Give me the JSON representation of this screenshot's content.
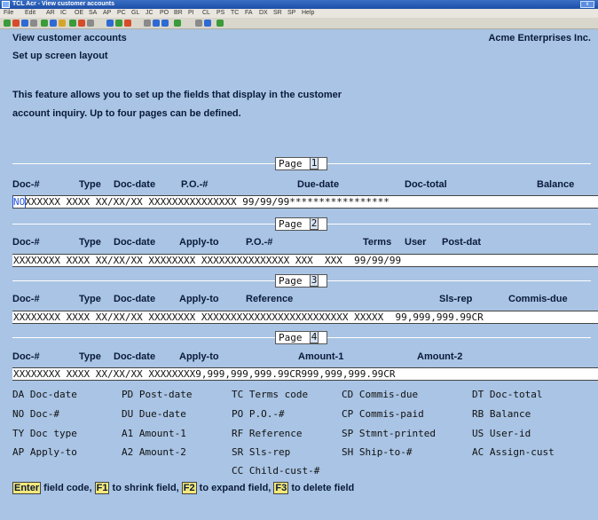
{
  "window": {
    "title": "TCL Acr - View customer accounts"
  },
  "menu": [
    "File",
    "Edit",
    "AR",
    "IC",
    "OE",
    "SA",
    "AP",
    "PC",
    "GL",
    "JC",
    "PO",
    "BR",
    "PI",
    "CL",
    "PS",
    "TC",
    "FA",
    "DX",
    "SR",
    "SP",
    "Help"
  ],
  "header": {
    "screen_title": "View customer accounts",
    "company": "Acme Enterprises Inc.",
    "subtitle": "Set up screen layout",
    "desc_line1": "This feature allows you to set up the fields that display in the customer",
    "desc_line2": "account inquiry.  Up to four pages can be defined."
  },
  "pages": [
    {
      "label": "Page",
      "number": "1",
      "headers": [
        "Doc-#",
        "Type",
        "Doc-date",
        "P.O.-#",
        "Due-date",
        "Doc-total",
        "Balance"
      ],
      "cursor": "NO",
      "field_prefix": "X",
      "field_rest": "XXXXX XXXX XX/XX/XX XXXXXXXXXXXXXXX 99/99/99*****************"
    },
    {
      "label": "Page",
      "number": "2",
      "headers": [
        "Doc-#",
        "Type",
        "Doc-date",
        "Apply-to",
        "P.O.-#",
        "Terms",
        "User",
        "Post-dat"
      ],
      "field": "XXXXXXXX XXXX XX/XX/XX XXXXXXXX XXXXXXXXXXXXXXX XXX  XXX  99/99/99"
    },
    {
      "label": "Page",
      "number": "3",
      "headers": [
        "Doc-#",
        "Type",
        "Doc-date",
        "Apply-to",
        "Reference",
        "Sls-rep",
        "Commis-due"
      ],
      "field": "XXXXXXXX XXXX XX/XX/XX XXXXXXXX XXXXXXXXXXXXXXXXXXXXXXXXX XXXXX  99,999,999.99CR"
    },
    {
      "label": "Page",
      "number": "4",
      "headers": [
        "Doc-#",
        "Type",
        "Doc-date",
        "Apply-to",
        "Amount-1",
        "Amount-2"
      ],
      "field": "XXXXXXXX XXXX XX/XX/XX XXXXXXXX9,999,999,999.99CR999,999,999.99CR"
    }
  ],
  "codes": [
    [
      "DA Doc-date",
      "PD Post-date",
      "TC Terms code",
      "CD Commis-due",
      "DT Doc-total"
    ],
    [
      "NO Doc-#",
      "DU Due-date",
      "PO P.O.-#",
      "CP Commis-paid",
      "RB Balance"
    ],
    [
      "TY Doc type",
      "A1 Amount-1",
      "RF Reference",
      "SP Stmnt-printed",
      "US User-id"
    ],
    [
      "AP Apply-to",
      "A2 Amount-2",
      "SR Sls-rep",
      "SH Ship-to-#",
      "AC Assign-cust"
    ],
    [
      "",
      "",
      "CC Child-cust-#",
      "",
      ""
    ]
  ],
  "footer": {
    "k1": "Enter",
    "t1": " field code, ",
    "k2": "F1",
    "t2": " to shrink field, ",
    "k3": "F2",
    "t3": " to expand field, ",
    "k4": "F3",
    "t4": " to delete field"
  }
}
